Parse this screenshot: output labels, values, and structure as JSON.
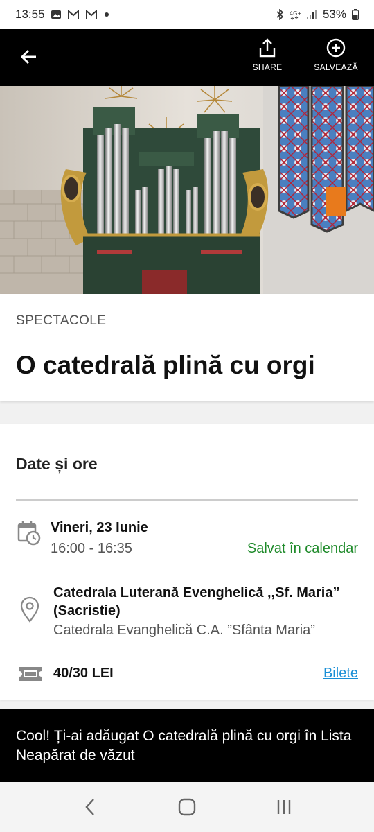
{
  "status": {
    "time": "13:55",
    "battery": "53%",
    "left_icons": [
      "gallery-icon",
      "gmail-icon",
      "gmail-icon",
      "dot-icon"
    ],
    "right_icons": [
      "bluetooth-icon",
      "4g-icon",
      "signal-icon",
      "battery-icon"
    ]
  },
  "app_bar": {
    "share_label": "SHARE",
    "save_label": "SALVEAZĂ"
  },
  "event": {
    "category": "SPECTACOLE",
    "title": "O catedrală plină cu orgi"
  },
  "details": {
    "section_title": "Date și ore",
    "date": "Vineri, 23 Iunie",
    "time": "16:00 - 16:35",
    "saved_status": "Salvat în calendar",
    "venue": "Catedrala Luterană Evenghelică ,,Sf. Maria” (Sacristie)",
    "venue_subtitle": "Catedrala Evanghelică C.A. ”Sfânta Maria”",
    "price": "40/30 LEI",
    "tickets_label": "Bilete"
  },
  "toast": {
    "message": "Cool! Ți-ai adăugat O catedrală plină cu orgi în Lista Neapărat de văzut"
  },
  "colors": {
    "accent_green": "#1e8a2a",
    "link_blue": "#1a8fd6",
    "app_bar": "#000000"
  }
}
